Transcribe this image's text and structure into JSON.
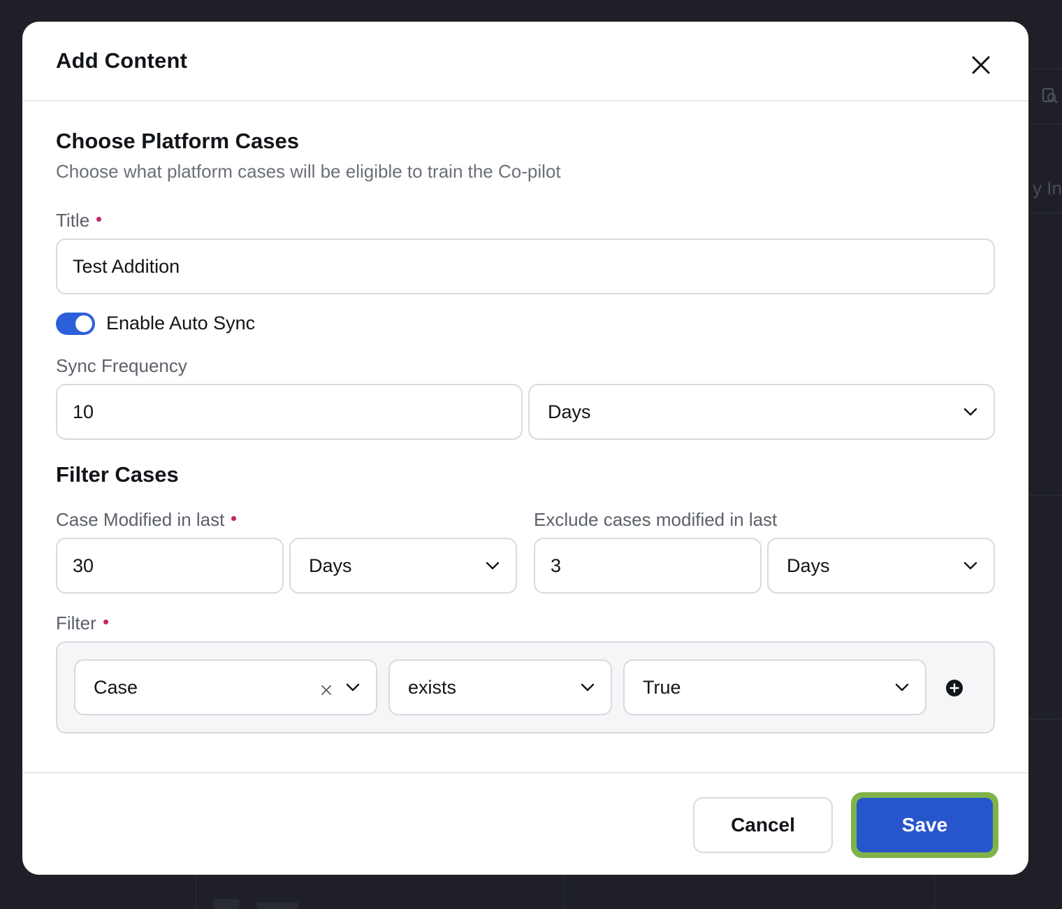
{
  "modal": {
    "title": "Add Content"
  },
  "platform_cases": {
    "heading": "Choose Platform Cases",
    "description": "Choose what platform cases will be eligible to train the Co-pilot"
  },
  "title_field": {
    "label": "Title",
    "value": "Test Addition"
  },
  "auto_sync": {
    "label": "Enable Auto Sync",
    "enabled": true
  },
  "sync_frequency": {
    "label": "Sync Frequency",
    "value": "10",
    "unit": "Days"
  },
  "filter_cases": {
    "heading": "Filter Cases",
    "modified_label": "Case Modified in last",
    "modified_value": "30",
    "modified_unit": "Days",
    "exclude_label": "Exclude cases modified in last",
    "exclude_value": "3",
    "exclude_unit": "Days"
  },
  "filter": {
    "label": "Filter",
    "field": "Case",
    "operator": "exists",
    "value": "True"
  },
  "footer": {
    "cancel_label": "Cancel",
    "save_label": "Save"
  },
  "colors": {
    "primary": "#2755cc",
    "toggle_on": "#2d5fdb",
    "required_dot": "#c4266a",
    "focus_ring": "#7fb34a"
  }
}
